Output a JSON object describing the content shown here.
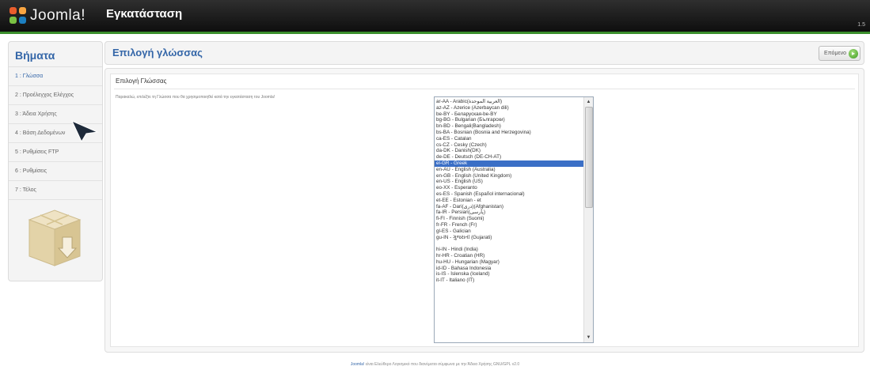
{
  "header": {
    "logo_text": "Joomla!",
    "title": "Εγκατάσταση",
    "version": "1.5"
  },
  "sidebar": {
    "heading": "Βήματα",
    "steps": [
      {
        "label": "1 : Γλώσσα"
      },
      {
        "label": "2 : Προέλεγχος Ελέγχος"
      },
      {
        "label": "3 : Άδεια Χρήσης"
      },
      {
        "label": "4 : Βάση Δεδομένων"
      },
      {
        "label": "5 : Ρυθμίσεις FTP"
      },
      {
        "label": "6 : Ρυθμίσεις"
      },
      {
        "label": "7 : Τέλος"
      }
    ],
    "active_step": 0
  },
  "main": {
    "title": "Επιλογή γλώσσας",
    "next_label": "Επόμενο",
    "section_title": "Επιλογή Γλώσσας",
    "instructions": "Παρακαλώ, επιλέξτε τη Γλώσσα που θα χρησιμοποιηθεί κατά την εγκατάσταση του Joomla!"
  },
  "languages": [
    "ar-AA - Arabic(العربية الموحدة)",
    "az-AZ - Azerice (Azerbaycan dili)",
    "be-BY - Беларуская-be-BY",
    "bg-BG - Bulgarian (Български)",
    "bn-BD - Bengali(Bangladesh)",
    "bs-BA - Bosnian (Bosnia and Herzegovina)",
    "ca-ES - Catalan",
    "cs-CZ - Česky (Czech)",
    "da-DK - Danish(DK)",
    "de-DE - Deutsch (DE-CH-AT)",
    "el-GR - Greek",
    "en-AU - English (Australia)",
    "en-GB - English (United Kingdom)",
    "en-US - English (US)",
    "eo-XX - Esperanto",
    "es-ES - Spanish (Español internacional)",
    "et-EE - Estonian - et",
    "fa-AF - Dari(دری)(Afghanistan)",
    "fa-IR - Persian(پارسی)",
    "fi-FI - Finnish (Suomi)",
    "fr-FR - French (Fr)",
    "gl-ES - Galician",
    "gu-IN - ગુજરાતી (Gujarati)",
    "",
    "hi-IN - Hindi (India)",
    "hr-HR - Croatian (HR)",
    "hu-HU - Hungarian (Magyar)",
    "id-ID - Bahasa Indonesia",
    "is-IS - Íslenska (Iceland)",
    "it-IT - Italiano (IT)"
  ],
  "selected_language_index": 10,
  "footer": {
    "link": "Joomla!",
    "text": " είναι Ελεύθερο Λογισμικό που διανέμεται σύμφωνα με την Άδεια Χρήσης GNU/GPL v2.0"
  },
  "colors": {
    "accent": "#3466a8",
    "header_bar": "#3a8e2c",
    "selection": "#3b6fc6"
  }
}
